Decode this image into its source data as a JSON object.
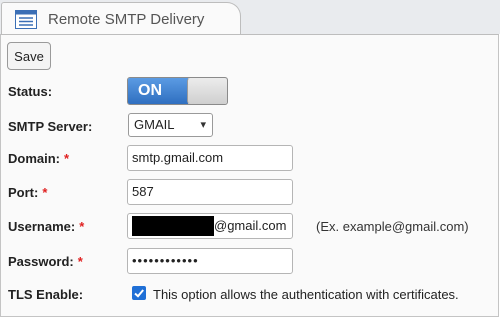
{
  "tab": {
    "title": "Remote SMTP Delivery",
    "icon": "table-list-icon"
  },
  "toolbar": {
    "save_label": "Save"
  },
  "form": {
    "status": {
      "label": "Status:",
      "value": "ON"
    },
    "smtp_server": {
      "label": "SMTP Server:",
      "value": "GMAIL"
    },
    "domain": {
      "label": "Domain:",
      "required_mark": "*",
      "value": "smtp.gmail.com"
    },
    "port": {
      "label": "Port:",
      "required_mark": "*",
      "value": "587"
    },
    "username": {
      "label": "Username:",
      "required_mark": "*",
      "value_suffix": "@gmail.com",
      "hint": "(Ex. example@gmail.com)"
    },
    "password": {
      "label": "Password:",
      "required_mark": "*",
      "value": "••••••••••••"
    },
    "tls": {
      "label": "TLS Enable:",
      "checked": true,
      "text": "This option allows the authentication with certificates."
    }
  },
  "colors": {
    "accent": "#3a7fd0",
    "required": "#e02020"
  }
}
